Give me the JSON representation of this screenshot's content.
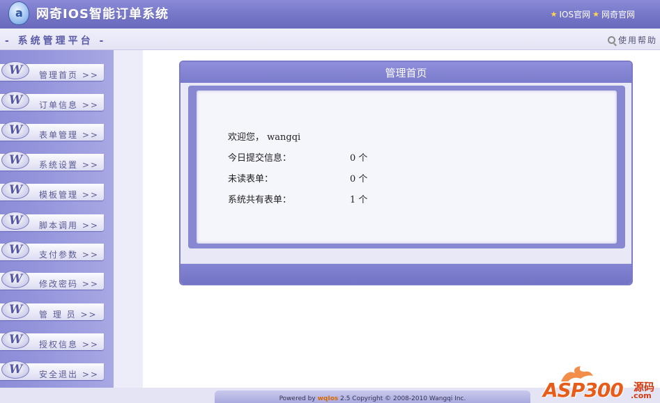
{
  "header": {
    "app_title": "网奇IOS智能订单系统",
    "links": [
      {
        "label": "IOS官网"
      },
      {
        "label": "网奇官网"
      }
    ]
  },
  "subheader": {
    "platform_title": "- 系统管理平台 -",
    "help_label": "使用帮助"
  },
  "sidebar": {
    "items": [
      {
        "label": "管理首页 >>"
      },
      {
        "label": "订单信息 >>"
      },
      {
        "label": "表单管理 >>"
      },
      {
        "label": "系统设置 >>"
      },
      {
        "label": "模板管理 >>"
      },
      {
        "label": "脚本调用 >>"
      },
      {
        "label": "支付参数 >>"
      },
      {
        "label": "修改密码 >>"
      },
      {
        "label": "管 理 员 >>"
      },
      {
        "label": "授权信息 >>"
      },
      {
        "label": "安全退出 >>"
      }
    ]
  },
  "main": {
    "panel_title": "管理首页",
    "welcome": "欢迎您，  wangqi",
    "stats": [
      {
        "label": "今日提交信息：",
        "value": "0 个"
      },
      {
        "label": "未读表单：",
        "value": "0 个"
      },
      {
        "label": "系统共有表单：",
        "value": "1 个"
      }
    ]
  },
  "footer": {
    "powered_prefix": "Powered by",
    "product": "wqIos",
    "rest": " 2.5  Copyright © 2008-2010   Wangqi Inc."
  },
  "watermark": {
    "text": "ASP300",
    "cn": "源码",
    "suffix": ".com"
  },
  "colors": {
    "accent": "#7b7bcc",
    "sidebar": "#9c9ce0",
    "panel_bg": "#f5f5fc",
    "brand_orange": "#e85c1a"
  }
}
